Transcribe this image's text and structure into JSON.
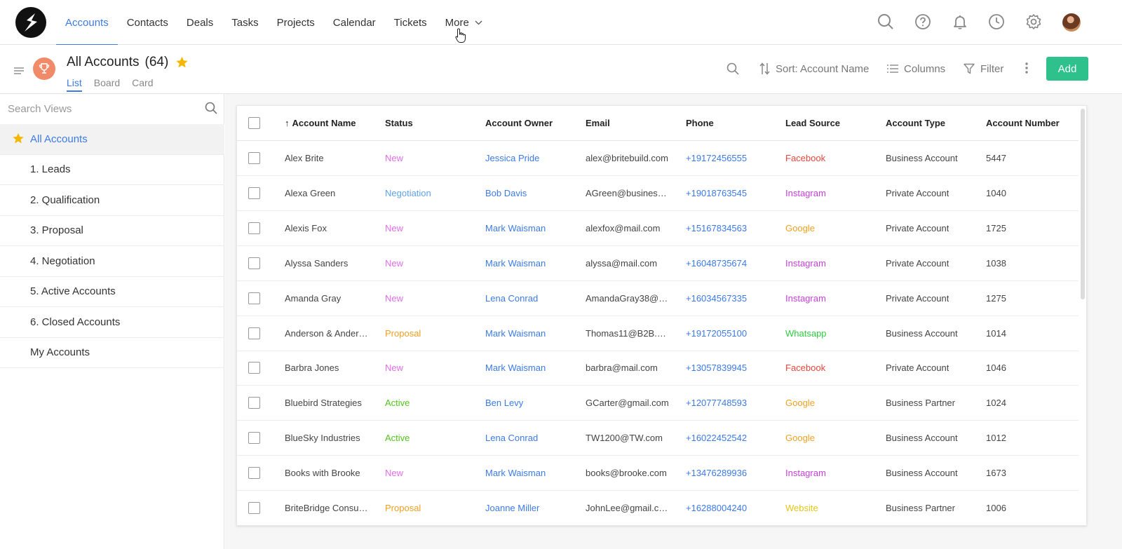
{
  "nav": {
    "items": [
      {
        "label": "Accounts",
        "active": true
      },
      {
        "label": "Contacts"
      },
      {
        "label": "Deals"
      },
      {
        "label": "Tasks"
      },
      {
        "label": "Projects"
      },
      {
        "label": "Calendar"
      },
      {
        "label": "Tickets"
      },
      {
        "label": "More"
      }
    ],
    "icons": [
      "search-icon",
      "help-icon",
      "bell-icon",
      "clock-icon",
      "gear-icon",
      "avatar"
    ]
  },
  "header": {
    "title": "All Accounts",
    "count": "(64)",
    "view_tabs": [
      "List",
      "Board",
      "Card"
    ],
    "active_tab": "List",
    "sort_label": "Sort: Account Name",
    "columns_label": "Columns",
    "filter_label": "Filter",
    "add_label": "Add"
  },
  "sidebar": {
    "search_placeholder": "Search Views",
    "views": [
      {
        "label": "All Accounts",
        "active": true
      },
      {
        "label": "1. Leads"
      },
      {
        "label": "2. Qualification"
      },
      {
        "label": "3. Proposal"
      },
      {
        "label": "4. Negotiation"
      },
      {
        "label": "5. Active Accounts"
      },
      {
        "label": "6. Closed Accounts"
      },
      {
        "label": "My Accounts"
      }
    ]
  },
  "table": {
    "sort_indicator": "↑",
    "columns": [
      "Account Name",
      "Status",
      "Account Owner",
      "Email",
      "Phone",
      "Lead Source",
      "Account Type",
      "Account Number"
    ],
    "rows": [
      [
        "Alex Brite",
        "New",
        "Jessica Pride",
        "alex@britebuild.com",
        "+19172456555",
        "Facebook",
        "Business Account",
        "5447"
      ],
      [
        "Alexa Green",
        "Negotiation",
        "Bob Davis",
        "AGreen@busines…",
        "+19018763545",
        "Instagram",
        "Private Account",
        "1040"
      ],
      [
        "Alexis Fox",
        "New",
        "Mark Waisman",
        "alexfox@mail.com",
        "+15167834563",
        "Google",
        "Private Account",
        "1725"
      ],
      [
        "Alyssa Sanders",
        "New",
        "Mark Waisman",
        "alyssa@mail.com",
        "+16048735674",
        "Instagram",
        "Private Account",
        "1038"
      ],
      [
        "Amanda Gray",
        "New",
        "Lena Conrad",
        "AmandaGray38@…",
        "+16034567335",
        "Instagram",
        "Private Account",
        "1275"
      ],
      [
        "Anderson & Ander…",
        "Proposal",
        "Mark Waisman",
        "Thomas11@B2B.…",
        "+19172055100",
        "Whatsapp",
        "Business Account",
        "1014"
      ],
      [
        "Barbra Jones",
        "New",
        "Mark Waisman",
        "barbra@mail.com",
        "+13057839945",
        "Facebook",
        "Private Account",
        "1046"
      ],
      [
        "Bluebird Strategies",
        "Active",
        "Ben Levy",
        "GCarter@gmail.com",
        "+12077748593",
        "Google",
        "Business Partner",
        "1024"
      ],
      [
        "BlueSky Industries",
        "Active",
        "Lena Conrad",
        "TW1200@TW.com",
        "+16022452542",
        "Google",
        "Business Account",
        "1012"
      ],
      [
        "Books with Brooke",
        "New",
        "Mark Waisman",
        "books@brooke.com",
        "+13476289936",
        "Instagram",
        "Business Account",
        "1673"
      ],
      [
        "BriteBridge Consu…",
        "Proposal",
        "Joanne Miller",
        "JohnLee@gmail.c…",
        "+16288004240",
        "Website",
        "Business Partner",
        "1006"
      ]
    ]
  },
  "colors": {
    "accent": "#3c7ae6",
    "add_button": "#2fc18c",
    "status": {
      "New": "#e26ee8",
      "Negotiation": "#5fa3e8",
      "Proposal": "#f0a020",
      "Active": "#52c41a"
    },
    "source": {
      "Facebook": "#e8453c",
      "Instagram": "#c53ed8",
      "Google": "#f0a020",
      "Whatsapp": "#2ecc40",
      "Website": "#e6c619"
    }
  }
}
